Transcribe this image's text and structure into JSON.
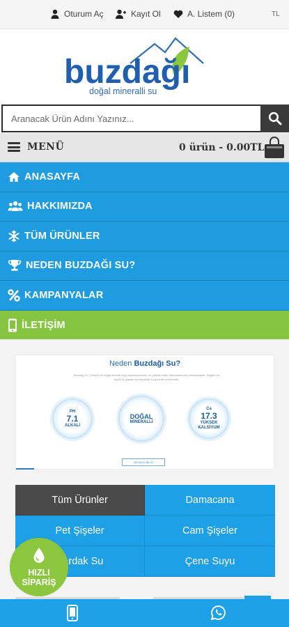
{
  "topbar": {
    "login": "Oturum Aç",
    "register": "Kayıt Ol",
    "wishlist": "A. Listem (0)",
    "currency": "TL"
  },
  "logo": {
    "brand": "buzdağı",
    "tagline": "doğal mineralli su"
  },
  "search": {
    "placeholder": "Aranacak Ürün Adını Yazınız..."
  },
  "menubar": {
    "menu_label": "MENÜ",
    "cart_summary": "0 ürün - 0.00TL"
  },
  "nav": {
    "items": [
      {
        "label": "ANASAYFA",
        "icon": "home-icon"
      },
      {
        "label": "HAKKIMIZDA",
        "icon": "users-icon"
      },
      {
        "label": "TÜM ÜRÜNLER",
        "icon": "snowflake-icon"
      },
      {
        "label": "NEDEN BUZDAĞI SU?",
        "icon": "trophy-icon"
      },
      {
        "label": "KAMPANYALAR",
        "icon": "percent-icon"
      },
      {
        "label": "İLETİŞİM",
        "icon": "mobile-icon"
      }
    ]
  },
  "banner": {
    "title_prefix": "Neden ",
    "title_brand": "Buzdağı Su?",
    "text": "Buzdağı Su, Türkiye'nin doğal mineral suyu kaynaklarından, en yüksek kalite standartlarında üretilmektedir. Sağlıklı ve keyifli bir yaşam için Buzdağı Su güvenle tercih edilir.",
    "circles": [
      {
        "top": "PH",
        "big": "7.1",
        "bottom": "ALKALİ"
      },
      {
        "top": "",
        "big": "DOĞAL",
        "bottom": "MİNERALLİ"
      },
      {
        "top": "Ca",
        "big": "17.3",
        "bottom": "YÜKSEK KALSİYUM"
      }
    ],
    "button": "DETAYLI BİLGİ"
  },
  "categories": [
    "Tüm Ürünler",
    "Damacana",
    "Pet Şişeler",
    "Cam Şişeler",
    "Bardak Su",
    "Çene Suyu"
  ],
  "quick_order": {
    "line1": "HIZLI",
    "line2": "SİPARİŞ"
  },
  "colors": {
    "primary_blue": "#1f9be0",
    "green": "#86c541",
    "dark": "#3a3a3a"
  }
}
